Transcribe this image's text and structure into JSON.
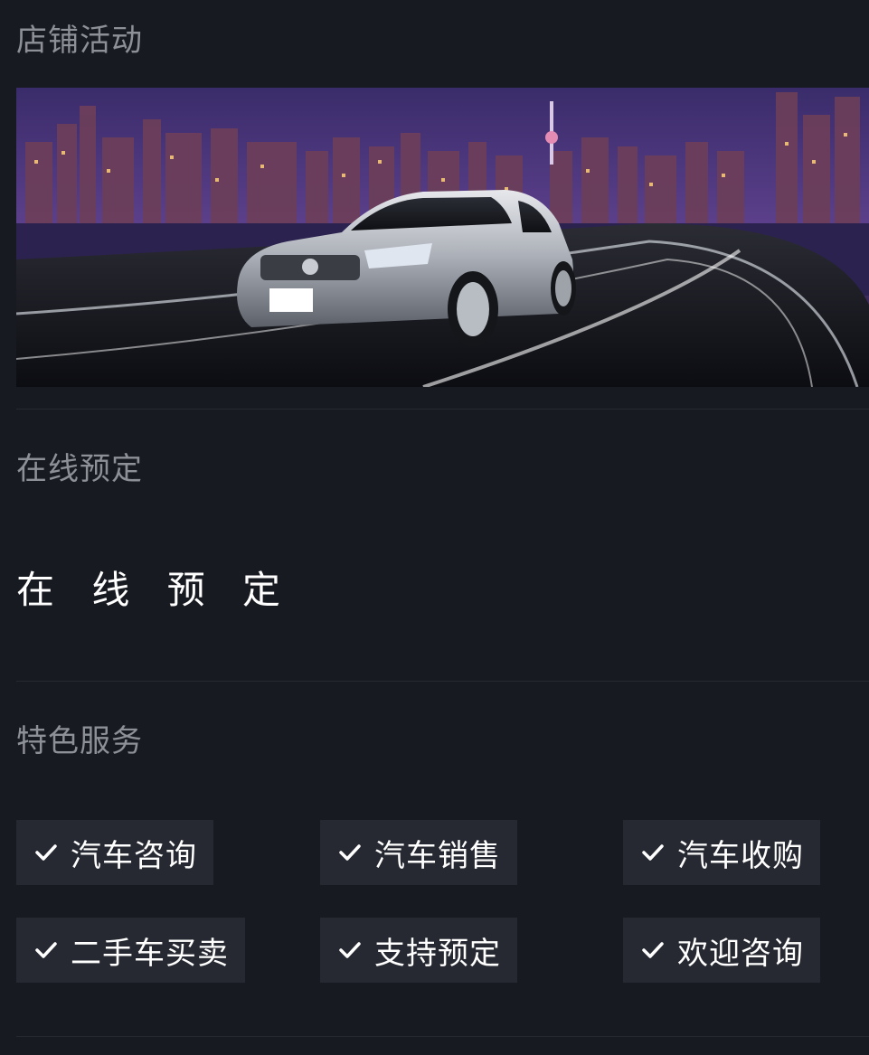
{
  "store_activity": {
    "title": "店铺活动",
    "banner_alt": "Camry banner"
  },
  "online_booking": {
    "title": "在线预定",
    "text": "在 线 预 定"
  },
  "features": {
    "title": "特色服务",
    "items": [
      {
        "label": "汽车咨询",
        "icon": "check-icon"
      },
      {
        "label": "汽车销售",
        "icon": "check-icon"
      },
      {
        "label": "汽车收购",
        "icon": "check-icon"
      },
      {
        "label": "二手车买卖",
        "icon": "check-icon"
      },
      {
        "label": "支持预定",
        "icon": "check-icon"
      },
      {
        "label": "欢迎咨询",
        "icon": "check-icon"
      }
    ]
  },
  "colors": {
    "background": "#181a21",
    "tag_background": "#262932",
    "section_title": "#8e9097",
    "text": "#ffffff"
  }
}
